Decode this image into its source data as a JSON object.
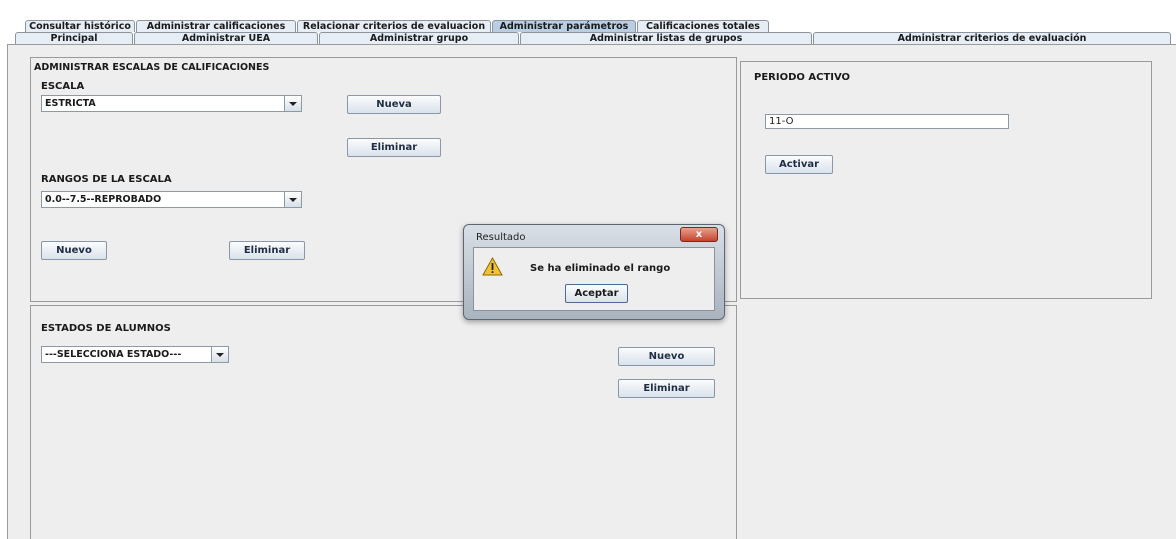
{
  "tabs_row1": [
    "Consultar histórico",
    "Administrar calificaciones",
    "Relacionar criterios de evaluacion",
    "Administrar parámetros",
    "Calificaciones totales"
  ],
  "tabs_row2": [
    "Principal",
    "Administrar UEA",
    "Administrar grupo",
    "Administrar listas de grupos",
    "Administrar criterios de evaluación"
  ],
  "escalas_panel": {
    "title": "ADMINISTRAR ESCALAS DE CALIFICACIONES",
    "escala_label": "ESCALA",
    "escala_value": "ESTRICTA",
    "nueva_button": "Nueva",
    "eliminar_button": "Eliminar",
    "rangos_label": "RANGOS DE LA ESCALA",
    "rango_value": "0.0--7.5--REPROBADO",
    "nuevo_button": "Nuevo",
    "eliminar_rango_button": "Eliminar"
  },
  "periodo_panel": {
    "title": "PERIODO ACTIVO",
    "periodo_value": "11-O",
    "activar_button": "Activar"
  },
  "estados_panel": {
    "title": "ESTADOS DE ALUMNOS",
    "estado_value": "---SELECCIONA ESTADO---",
    "nuevo_button": "Nuevo",
    "eliminar_button": "Eliminar"
  },
  "dialog": {
    "title": "Resultado",
    "close_glyph": "x",
    "message": "Se ha eliminado el rango",
    "ok_button": "Aceptar"
  }
}
